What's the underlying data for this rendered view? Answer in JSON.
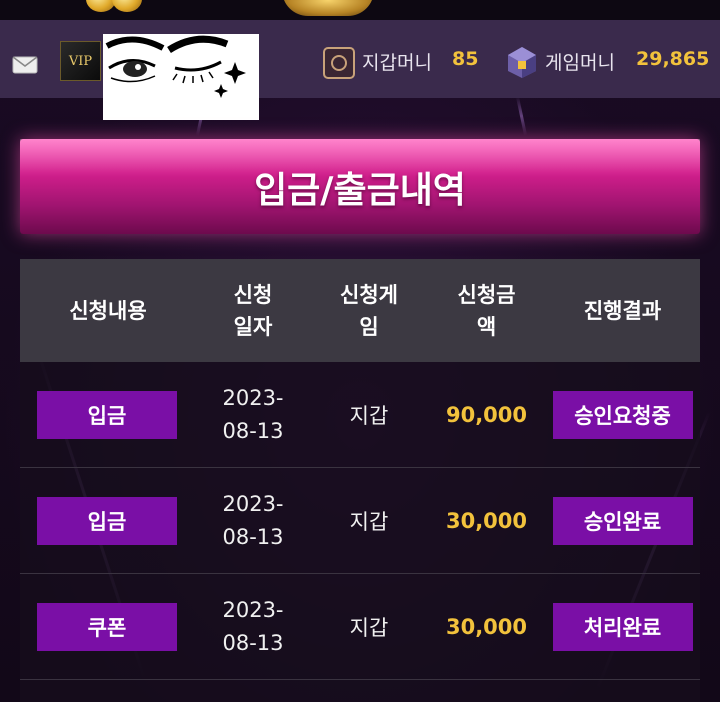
{
  "header": {
    "vip_badge": "VIP",
    "wallet_money_label": "지갑머니",
    "wallet_money_value": "85",
    "game_money_label": "게임머니",
    "game_money_value": "29,865"
  },
  "page": {
    "title": "입금/출금내역"
  },
  "table": {
    "columns": {
      "type": "신청내용",
      "date": "신청\n일자",
      "game": "신청게\n임",
      "amount": "신청금\n액",
      "status": "진행결과"
    },
    "rows": [
      {
        "type": "입금",
        "date": "2023-\n08-13",
        "game": "지갑",
        "amount": "90,000",
        "status": "승인요청중"
      },
      {
        "type": "입금",
        "date": "2023-\n08-13",
        "game": "지갑",
        "amount": "30,000",
        "status": "승인완료"
      },
      {
        "type": "쿠폰",
        "date": "2023-\n08-13",
        "game": "지갑",
        "amount": "30,000",
        "status": "처리완료"
      }
    ]
  },
  "colors": {
    "accent_gold": "#f2c23c",
    "button_purple": "#7a0fa6",
    "banner_pink": "#d31f8d",
    "header_bg": "#3a2a4c"
  }
}
